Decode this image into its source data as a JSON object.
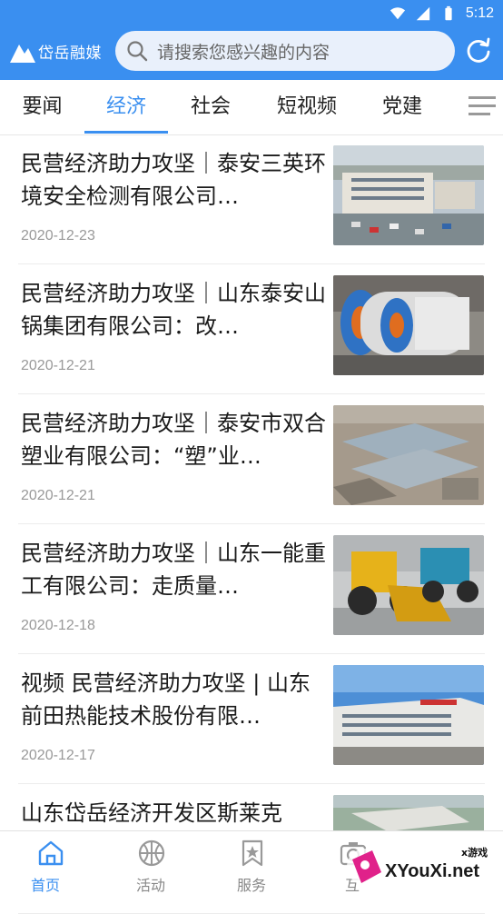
{
  "status_bar": {
    "time": "5:12"
  },
  "header": {
    "logo_text": "岱岳融媒",
    "search_placeholder": "请搜索您感兴趣的内容"
  },
  "tabs": [
    {
      "label": "要闻",
      "active": false
    },
    {
      "label": "经济",
      "active": true
    },
    {
      "label": "社会",
      "active": false
    },
    {
      "label": "短视频",
      "active": false
    },
    {
      "label": "党建",
      "active": false
    }
  ],
  "news": [
    {
      "title": "民营经济助力攻坚｜泰安三英环境安全检测有限公司…",
      "date": "2020-12-23",
      "thumb": "office-building"
    },
    {
      "title": "民营经济助力攻坚｜山东泰安山锅集团有限公司：改…",
      "date": "2020-12-21",
      "thumb": "boilers"
    },
    {
      "title": "民营经济助力攻坚｜泰安市双合塑业有限公司：“塑”业…",
      "date": "2020-12-21",
      "thumb": "factory-aerial"
    },
    {
      "title": "民营经济助力攻坚｜山东一能重工有限公司：走质量…",
      "date": "2020-12-18",
      "thumb": "wheel-loaders"
    },
    {
      "title": "视频 民营经济助力攻坚 | 山东前田热能技术股份有限…",
      "date": "2020-12-17",
      "thumb": "factory-building"
    },
    {
      "title": "山东岱岳经济开发区斯莱克",
      "date": "",
      "thumb": "aerial-park"
    }
  ],
  "bottom_nav": [
    {
      "label": "首页",
      "icon": "home-icon",
      "active": true
    },
    {
      "label": "活动",
      "icon": "basketball-icon",
      "active": false
    },
    {
      "label": "服务",
      "icon": "bookmark-star-icon",
      "active": false
    },
    {
      "label": "互",
      "icon": "camera-icon",
      "active": false
    }
  ],
  "watermark": {
    "text": "XYouXi.net",
    "small": "x游戏"
  },
  "colors": {
    "accent": "#3a8ff0"
  }
}
